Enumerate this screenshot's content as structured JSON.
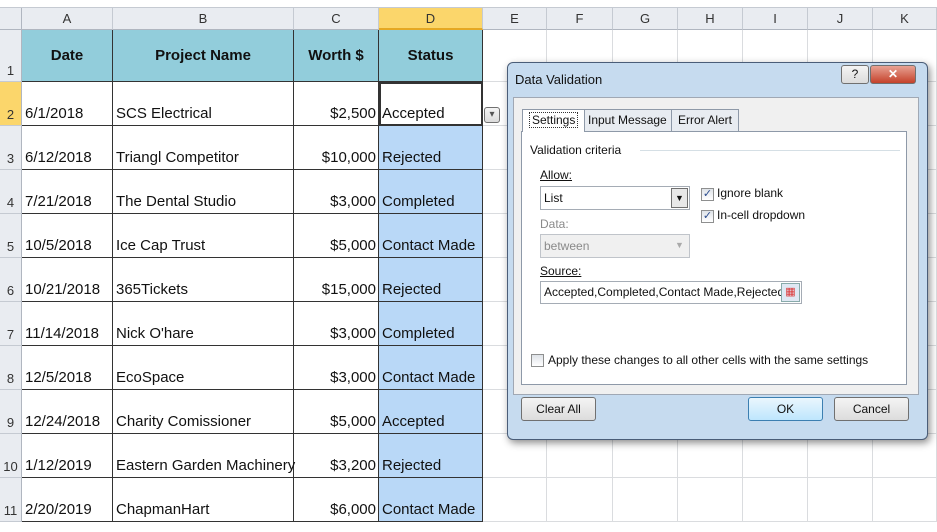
{
  "columns": [
    "A",
    "B",
    "C",
    "D",
    "E",
    "F",
    "G",
    "H",
    "I",
    "J",
    "K"
  ],
  "headers": {
    "date": "Date",
    "project": "Project Name",
    "worth": "Worth $",
    "status": "Status"
  },
  "rows": [
    {
      "n": "2",
      "date": "6/1/2018",
      "project": "SCS Electrical",
      "worth": "$2,500",
      "status": "Accepted"
    },
    {
      "n": "3",
      "date": "6/12/2018",
      "project": "Triangl Competitor",
      "worth": "$10,000",
      "status": "Rejected"
    },
    {
      "n": "4",
      "date": "7/21/2018",
      "project": "The Dental Studio",
      "worth": "$3,000",
      "status": "Completed"
    },
    {
      "n": "5",
      "date": "10/5/2018",
      "project": "Ice Cap Trust",
      "worth": "$5,000",
      "status": "Contact Made"
    },
    {
      "n": "6",
      "date": "10/21/2018",
      "project": "365Tickets",
      "worth": "$15,000",
      "status": "Rejected"
    },
    {
      "n": "7",
      "date": "11/14/2018",
      "project": "Nick O'hare",
      "worth": "$3,000",
      "status": "Completed"
    },
    {
      "n": "8",
      "date": "12/5/2018",
      "project": "EcoSpace",
      "worth": "$3,000",
      "status": "Contact Made"
    },
    {
      "n": "9",
      "date": "12/24/2018",
      "project": "Charity Comissioner",
      "worth": "$5,000",
      "status": "Accepted"
    },
    {
      "n": "10",
      "date": "1/12/2019",
      "project": "Eastern Garden Machinery",
      "worth": "$3,200",
      "status": "Rejected"
    },
    {
      "n": "11",
      "date": "2/20/2019",
      "project": "ChapmanHart",
      "worth": "$6,000",
      "status": "Contact Made"
    }
  ],
  "row1": "1",
  "dialog": {
    "title": "Data Validation",
    "help": "?",
    "close": "✕",
    "tabs": [
      "Settings",
      "Input Message",
      "Error Alert"
    ],
    "group": "Validation criteria",
    "allow_label": "Allow:",
    "allow_value": "List",
    "ignore_blank": "Ignore blank",
    "ignore_blank_checked": true,
    "in_cell": "In-cell dropdown",
    "in_cell_checked": true,
    "data_label": "Data:",
    "data_value": "between",
    "source_label": "Source:",
    "source_value": "Accepted,Completed,Contact Made,Rejected",
    "apply_all": "Apply these changes to all other cells with the same settings",
    "apply_all_checked": false,
    "clear_all": "Clear All",
    "ok": "OK",
    "cancel": "Cancel"
  }
}
